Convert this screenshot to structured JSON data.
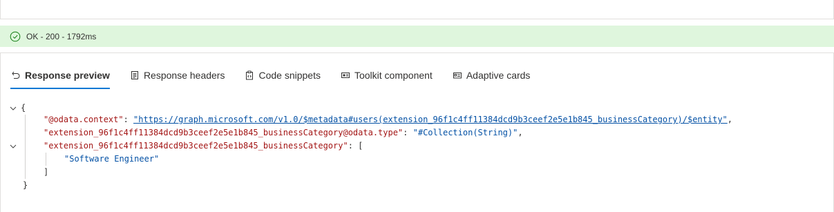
{
  "status": {
    "text": "OK - 200 - 1792ms",
    "color": "#dff6dd"
  },
  "tabs": [
    {
      "label": "Response preview",
      "icon": "undo-arrow-icon",
      "active": true
    },
    {
      "label": "Response headers",
      "icon": "document-icon",
      "active": false
    },
    {
      "label": "Code snippets",
      "icon": "code-clipboard-icon",
      "active": false
    },
    {
      "label": "Toolkit component",
      "icon": "component-icon",
      "active": false
    },
    {
      "label": "Adaptive cards",
      "icon": "card-icon",
      "active": false
    }
  ],
  "json": {
    "open_brace": "{",
    "close_brace": "}",
    "line1_key": "\"@odata.context\"",
    "line1_value": "\"https://graph.microsoft.com/v1.0/$metadata#users(extension_96f1c4ff11384dcd9b3ceef2e5e1b845_businessCategory)/$entity\"",
    "line2_key": "\"extension_96f1c4ff11384dcd9b3ceef2e5e1b845_businessCategory@odata.type\"",
    "line2_value": "\"#Collection(String)\"",
    "line3_key": "\"extension_96f1c4ff11384dcd9b3ceef2e5e1b845_businessCategory\"",
    "array_open": "[",
    "array_item": "\"Software Engineer\"",
    "array_close": "]",
    "colon": ": ",
    "comma": ","
  }
}
